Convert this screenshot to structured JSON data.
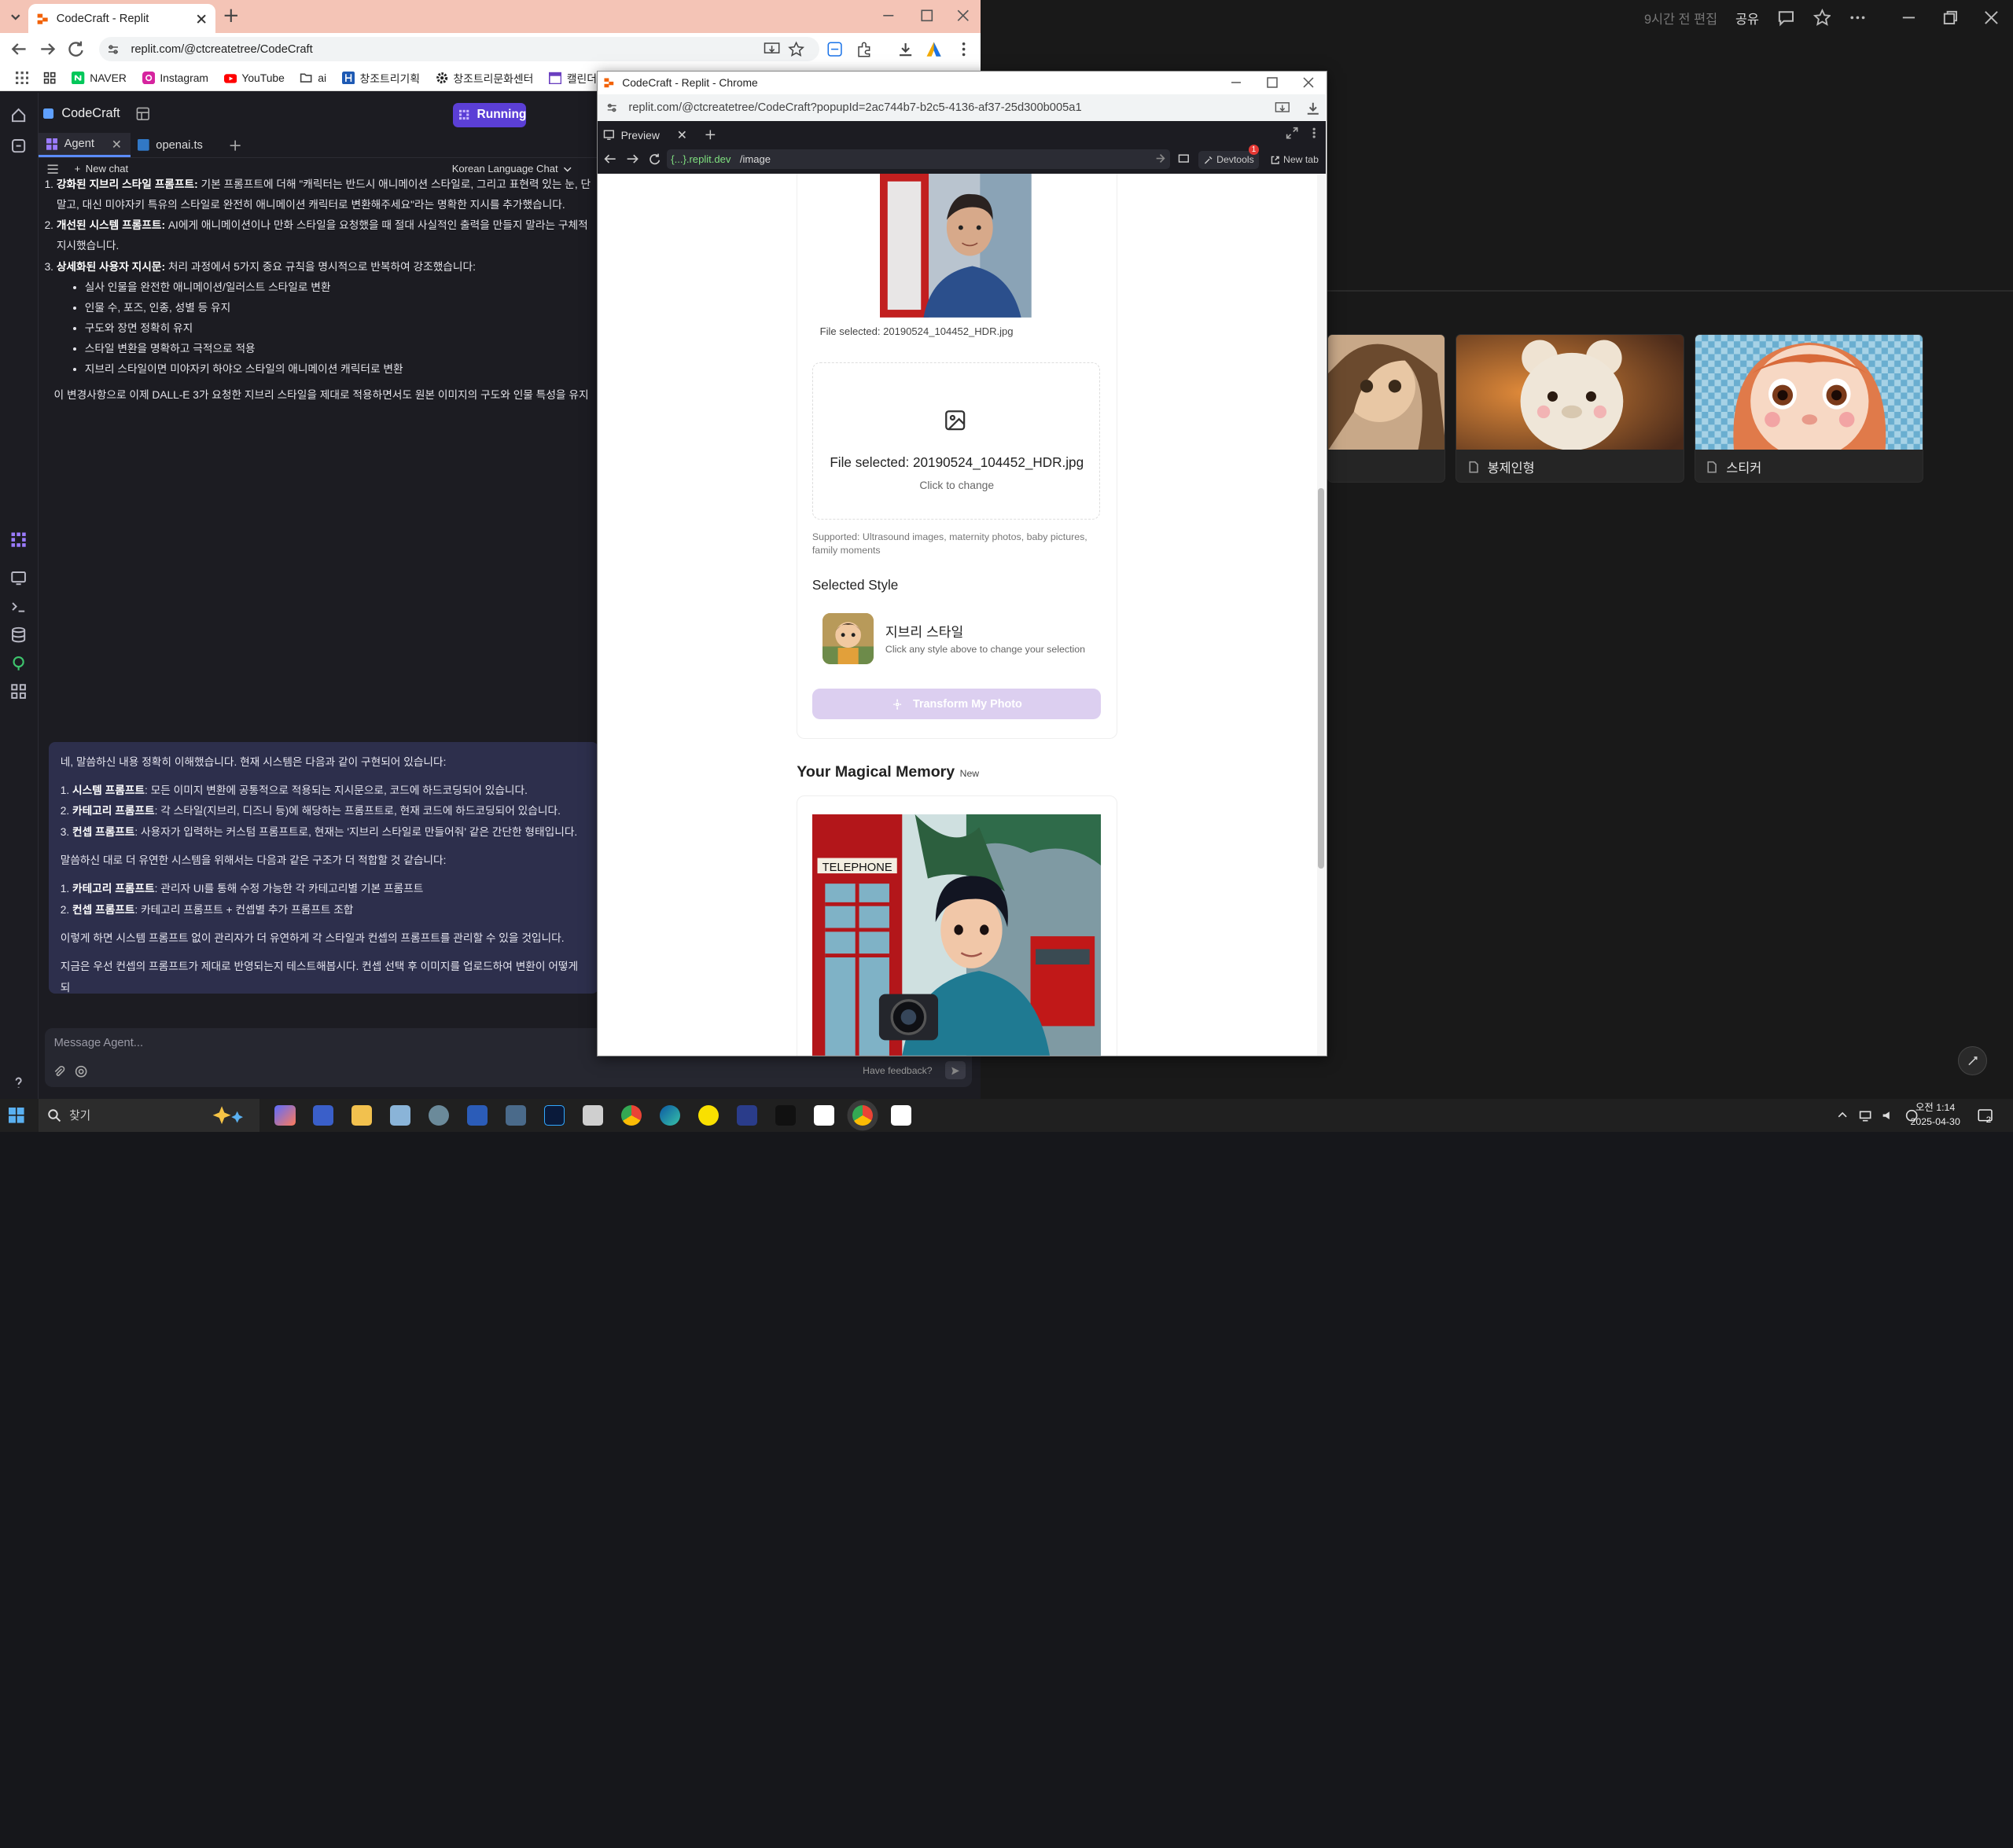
{
  "bg_app": {
    "edited": "9시간 전 편집",
    "share": "공유",
    "cards": [
      {
        "label": ""
      },
      {
        "label": "봉제인형"
      },
      {
        "label": "스티커"
      }
    ]
  },
  "browser": {
    "tab_title": "CodeCraft - Replit",
    "url": "replit.com/@ctcreatetree/CodeCraft",
    "bookmarks": [
      "NAVER",
      "Instagram",
      "YouTube",
      "ai",
      "창조트리기획",
      "창조트리문화센터",
      "캘린더"
    ]
  },
  "replit": {
    "project": "CodeCraft",
    "run_label": "Running",
    "tabs": [
      "Agent",
      "openai.ts"
    ],
    "new_chat": "New chat",
    "chat_title": "Korean Language Chat",
    "chat_lines": {
      "l1_b": "강화된 지브리 스타일 프롬프트:",
      "l1": " 기본 프롬프트에 더해 \"캐릭터는 반드시 애니메이션 스타일로, 그리고 표현력 있는 눈, 단",
      "l1b": "말고, 대신 미야자키 특유의 스타일로 완전히 애니메이션 캐릭터로 변환해주세요\"라는 명확한 지시를 추가했습니다.",
      "l2_b": "개선된 시스템 프롬프트:",
      "l2": " AI에게 애니메이션이나 만화 스타일을 요청했을 때 절대 사실적인 출력을 만들지 말라는 구체적",
      "l2b": "지시했습니다.",
      "l3_b": "상세화된 사용자 지시문:",
      "l3": " 처리 과정에서 5가지 중요 규칙을 명시적으로 반복하여 강조했습니다:",
      "bullets": [
        "실사 인물을 완전한 애니메이션/일러스트 스타일로 변환",
        "인물 수, 포즈, 인종, 성별 등 유지",
        "구도와 장면 정확히 유지",
        "스타일 변환을 명확하고 극적으로 적용",
        "지브리 스타일이면 미야자키 하야오 스타일의 애니메이션 캐릭터로 변환"
      ],
      "conclusion": "이 변경사항으로 이제 DALL-E 3가 요청한 지브리 스타일을 제대로 적용하면서도 원본 이미지의 구도와 인물 특성을 유지합"
    },
    "message": {
      "intro": "네, 말씀하신 내용 정확히 이해했습니다. 현재 시스템은 다음과 같이 구현되어 있습니다:",
      "items": [
        {
          "b": "시스템 프롬프트",
          "t": ": 모든 이미지 변환에 공통적으로 적용되는 지시문으로, 코드에 하드코딩되어 있습니다."
        },
        {
          "b": "카테고리 프롬프트",
          "t": ": 각 스타일(지브리, 디즈니 등)에 해당하는 프롬프트로, 현재 코드에 하드코딩되어 있습니다."
        },
        {
          "b": "컨셉 프롬프트",
          "t": ": 사용자가 입력하는 커스텀 프롬프트로, 현재는 '지브리 스타일로 만들어줘' 같은 간단한 형태입니다."
        }
      ],
      "mid": "말씀하신 대로 더 유연한 시스템을 위해서는 다음과 같은 구조가 더 적합할 것 같습니다:",
      "items2": [
        {
          "b": "카테고리 프롬프트",
          "t": ": 관리자 UI를 통해 수정 가능한 각 카테고리별 기본 프롬프트"
        },
        {
          "b": "컨셉 프롬프트",
          "t": ": 카테고리 프롬프트 + 컨셉별 추가 프롬프트 조합"
        }
      ],
      "p3": "이렇게 하면 시스템 프롬프트 없이 관리자가 더 유연하게 각 스타일과 컨셉의 프롬프트를 관리할 수 있을 것입니다.",
      "p4": "지금은 우선 컨셉의 프롬프트가 제대로 반영되는지 테스트해봅시다. 컨셉 선택 후 이미지를 업로드하여 변환이 어떻게 되"
    },
    "input_placeholder": "Message Agent...",
    "feedback": "Have feedback?"
  },
  "popup": {
    "title": "CodeCraft - Replit - Chrome",
    "url": "replit.com/@ctcreatetree/CodeCraft?popupId=2ac744b7-b2c5-4136-af37-25d300b005a1",
    "preview_tab": "Preview",
    "host": "{...}.replit.dev",
    "path": "/image",
    "devtools": "Devtools",
    "devtools_badge": "1",
    "new_tab": "New tab"
  },
  "page": {
    "file_selected_small": "File selected: 20190524_104452_HDR.jpg",
    "file_selected": "File selected: 20190524_104452_HDR.jpg",
    "click_to_change": "Click to change",
    "supported": "Supported: Ultrasound images, maternity photos, baby pictures, family moments",
    "selected_style_title": "Selected Style",
    "style_name": "지브리 스타일",
    "style_hint": "Click any style above to change your selection",
    "transform_btn": "Transform My Photo",
    "memory_title": "Your Magical Memory",
    "memory_badge": "New",
    "telephone": "TELEPHONE"
  },
  "taskbar": {
    "search": "찾기",
    "time": "오전 1:14",
    "date": "2025-04-30",
    "notif": "2"
  }
}
